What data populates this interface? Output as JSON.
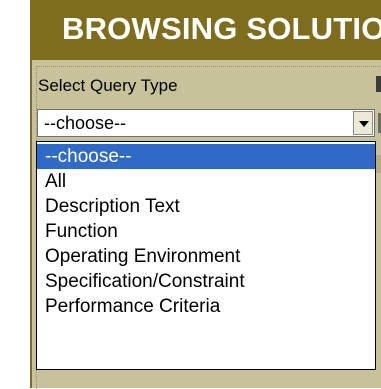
{
  "header": {
    "title": "BROWSING SOLUTIO"
  },
  "form": {
    "query_label": "Select Query Type",
    "select": {
      "value": "--choose--",
      "options": [
        "--choose--",
        "All",
        "Description Text",
        "Function",
        "Operating Environment",
        "Specification/Constraint",
        "Performance Criteria"
      ],
      "highlighted_option": "--choose--"
    }
  },
  "colors": {
    "header_bg": "#7f6d1f",
    "panel_bg": "#c7c29b",
    "highlight": "#3169c6"
  },
  "icons": {
    "dropdown_arrow": "chevron-down-icon"
  }
}
